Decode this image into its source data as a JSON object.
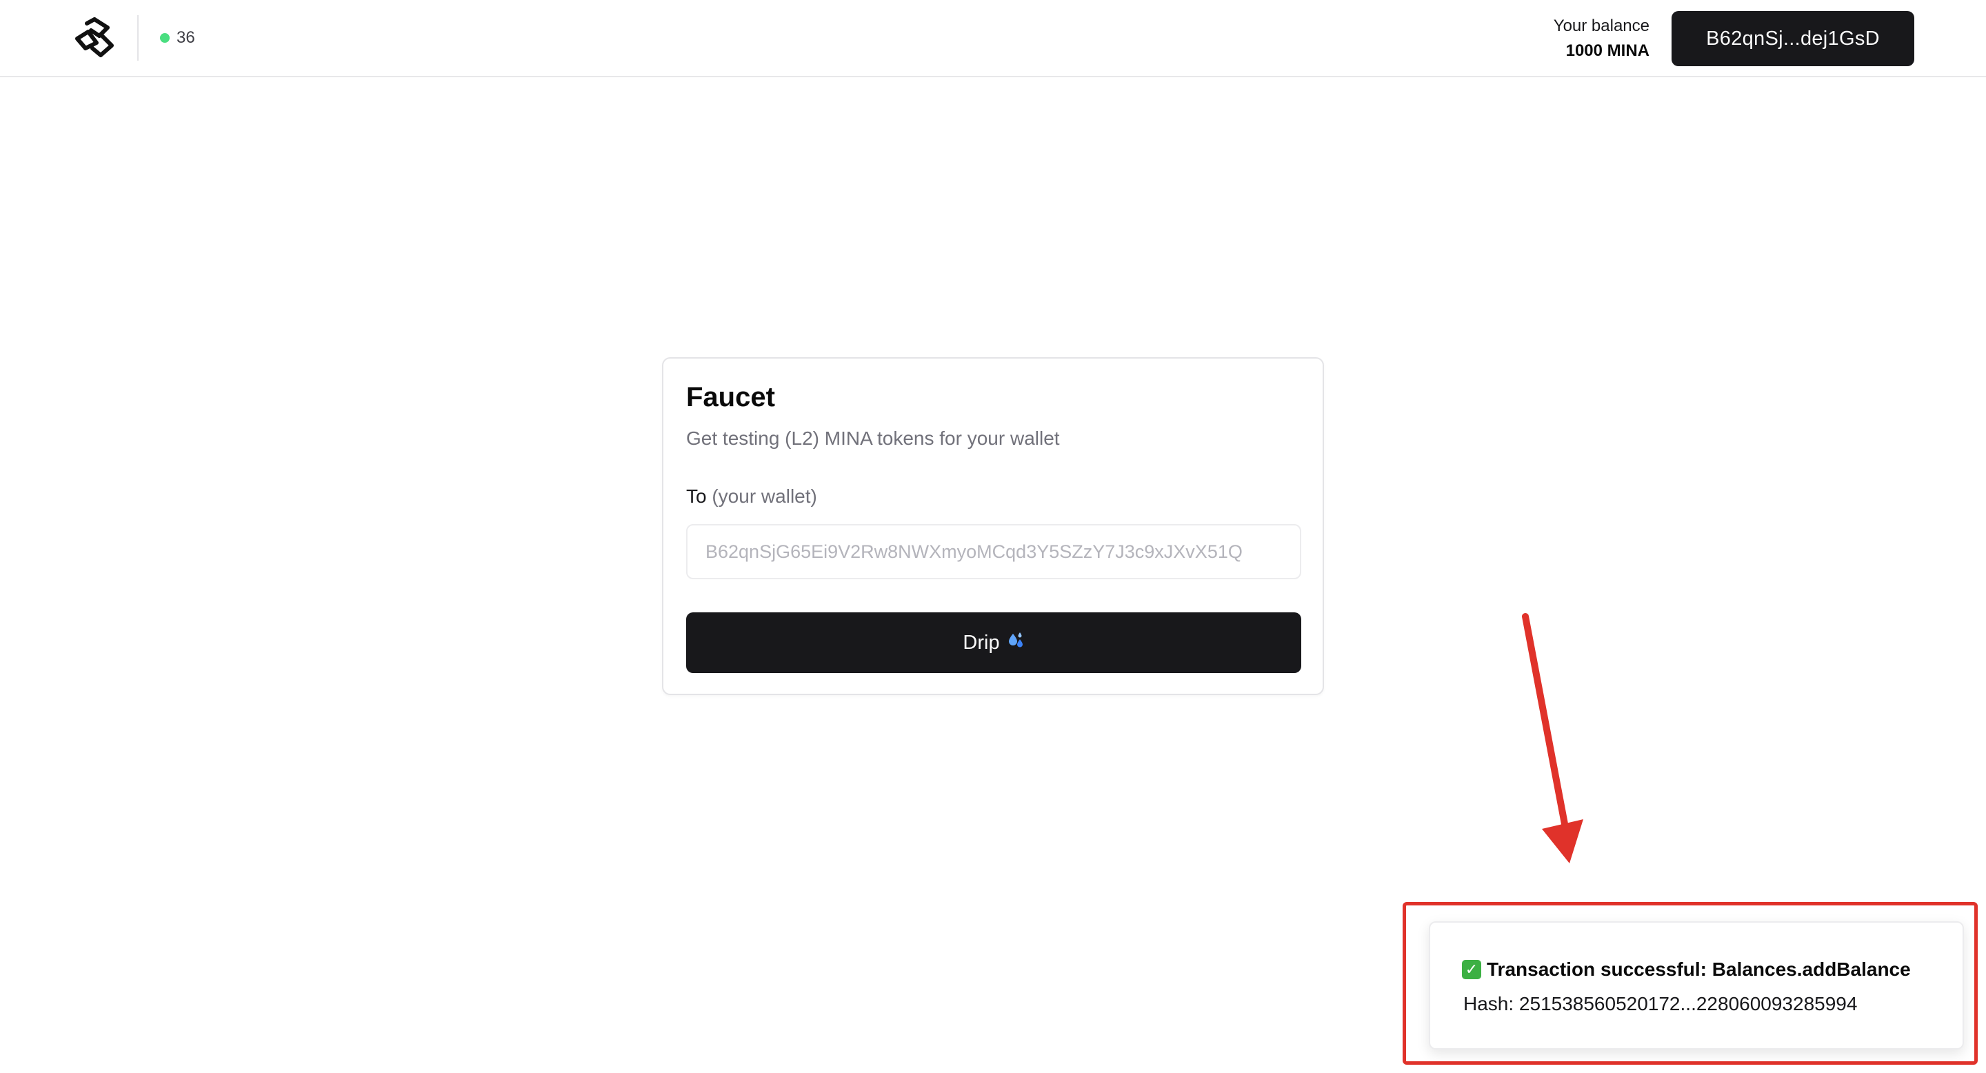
{
  "header": {
    "block_height": "36",
    "balance_label": "Your balance",
    "balance_value": "1000 MINA",
    "wallet_button_label": "B62qnSj...dej1GsD",
    "status_color": "#4ade80"
  },
  "faucet": {
    "title": "Faucet",
    "subtitle": "Get testing (L2) MINA tokens for your wallet",
    "field_label": "To",
    "field_hint": "(your wallet)",
    "wallet_placeholder": "B62qnSjG65Ei9V2Rw8NWXmyoMCqd3Y5SZzY7J3c9xJXvX51Q",
    "drip_label": "Drip",
    "drip_icon": "droplets-icon"
  },
  "toast": {
    "title": "Transaction successful: Balances.addBalance",
    "hash": "Hash: 251538560520172...228060093285994",
    "icon": "check-mark-icon"
  },
  "colors": {
    "primary_dark": "#18181b",
    "annotation_red": "#e0322a",
    "success_green": "#3cb043"
  }
}
